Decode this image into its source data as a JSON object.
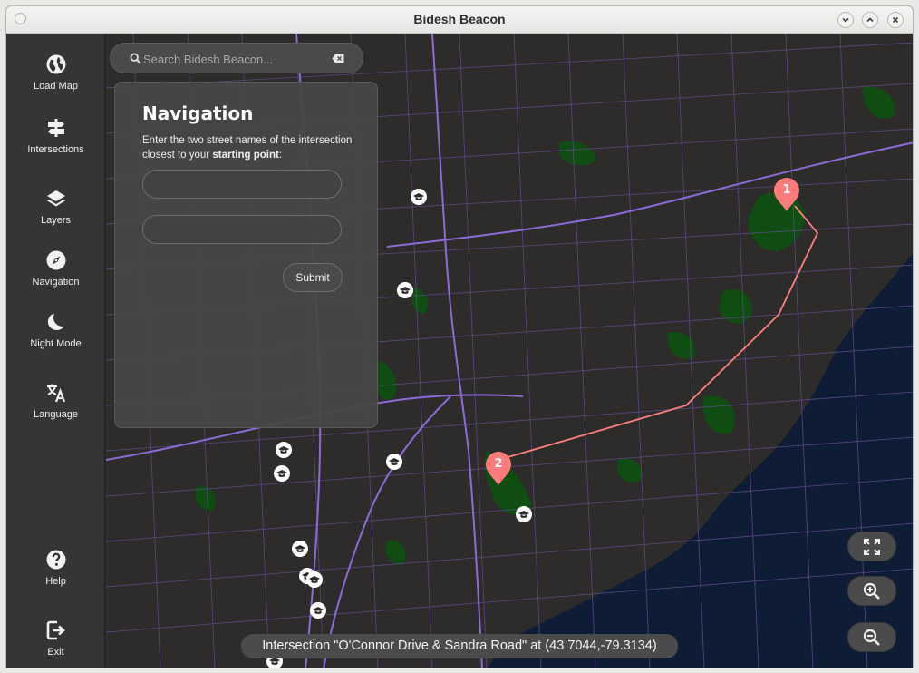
{
  "window": {
    "title": "Bidesh Beacon"
  },
  "sidebar": {
    "items": [
      {
        "label": "Load Map",
        "icon": "globe-icon"
      },
      {
        "label": "Intersections",
        "icon": "signpost-icon"
      },
      {
        "label": "Layers",
        "icon": "layers-icon"
      },
      {
        "label": "Navigation",
        "icon": "compass-icon"
      },
      {
        "label": "Night Mode",
        "icon": "moon-icon"
      },
      {
        "label": "Language",
        "icon": "translate-icon"
      },
      {
        "label": "Help",
        "icon": "help-icon"
      },
      {
        "label": "Exit",
        "icon": "exit-icon"
      }
    ]
  },
  "search": {
    "placeholder": "Search Bidesh Beacon...",
    "value": ""
  },
  "navigation": {
    "title": "Navigation",
    "description_prefix": "Enter the two street names of the intersection closest to your ",
    "description_bold": "starting point",
    "description_suffix": ":",
    "field1": "",
    "field2": "",
    "submit_label": "Submit"
  },
  "map": {
    "markers": [
      {
        "label": "1"
      },
      {
        "label": "2"
      }
    ],
    "route_color": "#ff8080",
    "marker_color": "#ff7b7b",
    "road_color": "#8d6bd6",
    "park_color": "#0f4d12",
    "water_color": "#0e1d35"
  },
  "status": {
    "text": "Intersection \"O'Connor Drive & Sandra Road\" at (43.7044,-79.3134)"
  }
}
